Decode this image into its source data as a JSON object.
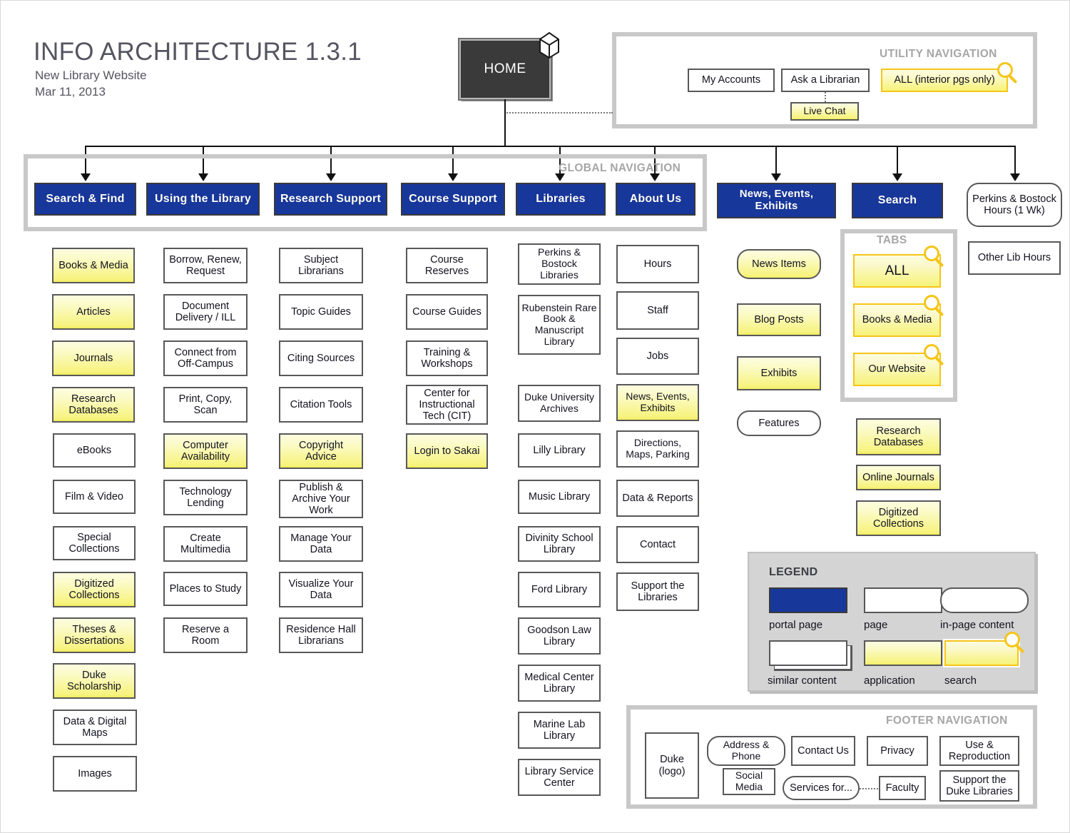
{
  "title": "INFO ARCHITECTURE 1.3.1",
  "subtitle": "New Library Website",
  "date": "Mar 11, 2013",
  "home": {
    "label": "HOME"
  },
  "colors": {
    "portal_blue": "#17379b",
    "application_yellow": "#f7f37e",
    "search_outline": "#f5c518",
    "frame_gray": "#c8c8c8",
    "legend_bg": "#d4d4d4",
    "node_border": "#58585a"
  },
  "utility_navigation": {
    "label": "UTILITY NAVIGATION",
    "items": [
      {
        "label": "My Accounts",
        "type": "page"
      },
      {
        "label": "Ask a Librarian",
        "type": "page"
      },
      {
        "label": "ALL (interior pgs only)",
        "type": "search"
      },
      {
        "label": "Live Chat",
        "type": "application"
      }
    ]
  },
  "global_navigation": {
    "label": "GLOBAL NAVIGATION",
    "items": [
      {
        "label": "Search & Find"
      },
      {
        "label": "Using the Library"
      },
      {
        "label": "Research Support"
      },
      {
        "label": "Course Support"
      },
      {
        "label": "Libraries"
      },
      {
        "label": "About Us"
      }
    ]
  },
  "top_level_extra": [
    {
      "label": "News, Events, Exhibits",
      "type": "portal"
    },
    {
      "label": "Search",
      "type": "portal"
    },
    {
      "label": "Perkins & Bostock Hours (1 Wk)",
      "type": "in-page content"
    }
  ],
  "other_lib_hours": {
    "label": "Other Lib Hours",
    "type": "page"
  },
  "columns": [
    {
      "parent": "Search & Find",
      "children": [
        {
          "label": "Books & Media",
          "type": "application"
        },
        {
          "label": "Articles",
          "type": "application"
        },
        {
          "label": "Journals",
          "type": "application"
        },
        {
          "label": "Research Databases",
          "type": "application"
        },
        {
          "label": "eBooks",
          "type": "page"
        },
        {
          "label": "Film & Video",
          "type": "page"
        },
        {
          "label": "Special Collections",
          "type": "page"
        },
        {
          "label": "Digitized Collections",
          "type": "application"
        },
        {
          "label": "Theses & Dissertations",
          "type": "application"
        },
        {
          "label": "Duke Scholarship",
          "type": "application"
        },
        {
          "label": "Data & Digital Maps",
          "type": "page"
        },
        {
          "label": "Images",
          "type": "page"
        }
      ]
    },
    {
      "parent": "Using the Library",
      "children": [
        {
          "label": "Borrow, Renew, Request",
          "type": "page"
        },
        {
          "label": "Document Delivery / ILL",
          "type": "page"
        },
        {
          "label": "Connect from Off-Campus",
          "type": "page"
        },
        {
          "label": "Print, Copy, Scan",
          "type": "page"
        },
        {
          "label": "Computer Availability",
          "type": "application"
        },
        {
          "label": "Technology Lending",
          "type": "page"
        },
        {
          "label": "Create Multimedia",
          "type": "page"
        },
        {
          "label": "Places to Study",
          "type": "page"
        },
        {
          "label": "Reserve a Room",
          "type": "page"
        }
      ]
    },
    {
      "parent": "Research Support",
      "children": [
        {
          "label": "Subject Librarians",
          "type": "page"
        },
        {
          "label": "Topic Guides",
          "type": "page"
        },
        {
          "label": "Citing Sources",
          "type": "page"
        },
        {
          "label": "Citation Tools",
          "type": "page"
        },
        {
          "label": "Copyright Advice",
          "type": "application"
        },
        {
          "label": "Publish & Archive Your Work",
          "type": "page"
        },
        {
          "label": "Manage Your Data",
          "type": "page"
        },
        {
          "label": "Visualize Your Data",
          "type": "page"
        },
        {
          "label": "Residence Hall Librarians",
          "type": "page"
        }
      ]
    },
    {
      "parent": "Course Support",
      "children": [
        {
          "label": "Course Reserves",
          "type": "page"
        },
        {
          "label": "Course Guides",
          "type": "page"
        },
        {
          "label": "Training & Workshops",
          "type": "page"
        },
        {
          "label": "Center for Instructional Tech (CIT)",
          "type": "page"
        },
        {
          "label": "Login to Sakai",
          "type": "application"
        }
      ]
    },
    {
      "parent": "Libraries",
      "children": [
        {
          "label": "Perkins & Bostock Libraries",
          "type": "page"
        },
        {
          "label": "Rubenstein Rare Book & Manuscript Library",
          "type": "page"
        },
        {
          "label": "Duke University Archives",
          "type": "page"
        },
        {
          "label": "Lilly Library",
          "type": "page"
        },
        {
          "label": "Music Library",
          "type": "page"
        },
        {
          "label": "Divinity School Library",
          "type": "page"
        },
        {
          "label": "Ford Library",
          "type": "page"
        },
        {
          "label": "Goodson Law Library",
          "type": "page"
        },
        {
          "label": "Medical Center Library",
          "type": "page"
        },
        {
          "label": "Marine Lab Library",
          "type": "page"
        },
        {
          "label": "Library Service Center",
          "type": "page"
        }
      ]
    },
    {
      "parent": "About Us",
      "children": [
        {
          "label": "Hours",
          "type": "page"
        },
        {
          "label": "Staff",
          "type": "page"
        },
        {
          "label": "Jobs",
          "type": "page"
        },
        {
          "label": "News, Events, Exhibits",
          "type": "application"
        },
        {
          "label": "Directions, Maps, Parking",
          "type": "page"
        },
        {
          "label": "Data & Reports",
          "type": "page"
        },
        {
          "label": "Contact",
          "type": "page"
        },
        {
          "label": "Support the Libraries",
          "type": "page"
        }
      ]
    },
    {
      "parent": "News, Events, Exhibits",
      "children": [
        {
          "label": "News Items",
          "type": "in-page content, similar content, application"
        },
        {
          "label": "Blog Posts",
          "type": "similar content, application"
        },
        {
          "label": "Exhibits",
          "type": "application"
        },
        {
          "label": "Features",
          "type": "in-page content, similar content"
        }
      ]
    }
  ],
  "tabs_group": {
    "label": "TABS",
    "items": [
      {
        "label": "ALL",
        "type": "search"
      },
      {
        "label": "Books & Media",
        "type": "search"
      },
      {
        "label": "Our Website",
        "type": "search"
      }
    ]
  },
  "search_children": [
    {
      "label": "Research Databases",
      "type": "application"
    },
    {
      "label": "Online Journals",
      "type": "application"
    },
    {
      "label": "Digitized Collections",
      "type": "application"
    }
  ],
  "legend": {
    "label": "LEGEND",
    "items": [
      {
        "label": "portal page",
        "swatch": "portal"
      },
      {
        "label": "page",
        "swatch": "page"
      },
      {
        "label": "in-page content",
        "swatch": "inpage"
      },
      {
        "label": "similar content",
        "swatch": "stack"
      },
      {
        "label": "application",
        "swatch": "app"
      },
      {
        "label": "search",
        "swatch": "search"
      }
    ]
  },
  "footer_navigation": {
    "label": "FOOTER NAVIGATION",
    "items": [
      {
        "label": "Duke (logo)",
        "type": "page"
      },
      {
        "label": "Address & Phone",
        "type": "in-page content"
      },
      {
        "label": "Contact Us",
        "type": "page"
      },
      {
        "label": "Privacy",
        "type": "page"
      },
      {
        "label": "Use & Reproduction",
        "type": "page"
      },
      {
        "label": "Social Media",
        "type": "similar content"
      },
      {
        "label": "Services for...",
        "type": "in-page content"
      },
      {
        "label": "Faculty",
        "type": "similar content"
      },
      {
        "label": "Support the Duke Libraries",
        "type": "page"
      }
    ]
  }
}
